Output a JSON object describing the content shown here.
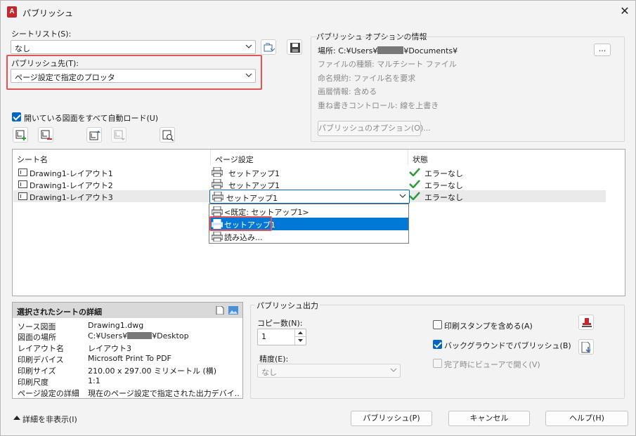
{
  "window": {
    "title": "パブリッシュ",
    "app_icon_letter": "A"
  },
  "sheet_list": {
    "label": "シートリスト(S):",
    "value": "なし"
  },
  "publish_to": {
    "label": "パブリッシュ先(T):",
    "value": "ページ設定で指定のプロッタ"
  },
  "auto_load": {
    "label": "開いている図面をすべて自動ロード(U)",
    "checked": true
  },
  "options_info": {
    "title": "パブリッシュ オプションの情報",
    "location_label": "場所:",
    "location_prefix": "C:¥Users¥",
    "location_suffix": "¥Documents¥",
    "location_button": "...",
    "file_type": "ファイルの種類: マルチシート ファイル",
    "naming": "命名規約: ファイル名を要求",
    "layer_info": "画層情報: 含める",
    "overwrite": "重ね書きコントロール: 線を上書き",
    "options_button": "パブリッシュのオプション(O)..."
  },
  "table": {
    "col_sheet": "シート名",
    "col_pagesetup": "ページ設定",
    "col_status": "状態",
    "rows": [
      {
        "sheet": "Drawing1-レイアウト1",
        "setup": "セットアップ1",
        "status": "エラーなし"
      },
      {
        "sheet": "Drawing1-レイアウト2",
        "setup": "セットアップ1",
        "status": "エラーなし"
      },
      {
        "sheet": "Drawing1-レイアウト3",
        "setup": "セットアップ1",
        "status": "エラーなし"
      }
    ],
    "dropdown_items": [
      "<既定: セットアップ1>",
      "セットアップ1",
      "読み込み..."
    ]
  },
  "details": {
    "title": "選択されたシートの詳細",
    "rows": [
      {
        "k": "ソース図面",
        "v": "Drawing1.dwg"
      },
      {
        "k": "図面の場所",
        "v_prefix": "C:¥Users¥",
        "v_suffix": "¥Desktop"
      },
      {
        "k": "レイアウト名",
        "v": "レイアウト3"
      },
      {
        "k": "印刷デバイス",
        "v": "Microsoft Print To PDF"
      },
      {
        "k": "印刷サイズ",
        "v": "210.00 x 297.00 ミリメートル (横)"
      },
      {
        "k": "印刷尺度",
        "v": "1:1"
      },
      {
        "k": "ページ設定の詳細",
        "v": "現在のページ設定で指定された出力デバイ..."
      }
    ]
  },
  "publish_output": {
    "title": "パブリッシュ出力",
    "copies_label": "コピー数(N):",
    "copies_value": "1",
    "precision_label": "精度(E):",
    "precision_value": "なし",
    "stamp_label": "印刷スタンプを含める(A)",
    "stamp_checked": false,
    "background_label": "バックグラウンドでパブリッシュ(B)",
    "background_checked": true,
    "viewer_label": "完了時にビューアで開く(V)",
    "viewer_checked": false
  },
  "footer": {
    "hide_details": "詳細を非表示(I)",
    "publish": "パブリッシュ(P)",
    "cancel": "キャンセル",
    "help": "ヘルプ(H)"
  },
  "colors": {
    "accent": "#0078d7",
    "highlight_box": "#e05555",
    "ok_green": "#2a9d3a"
  }
}
